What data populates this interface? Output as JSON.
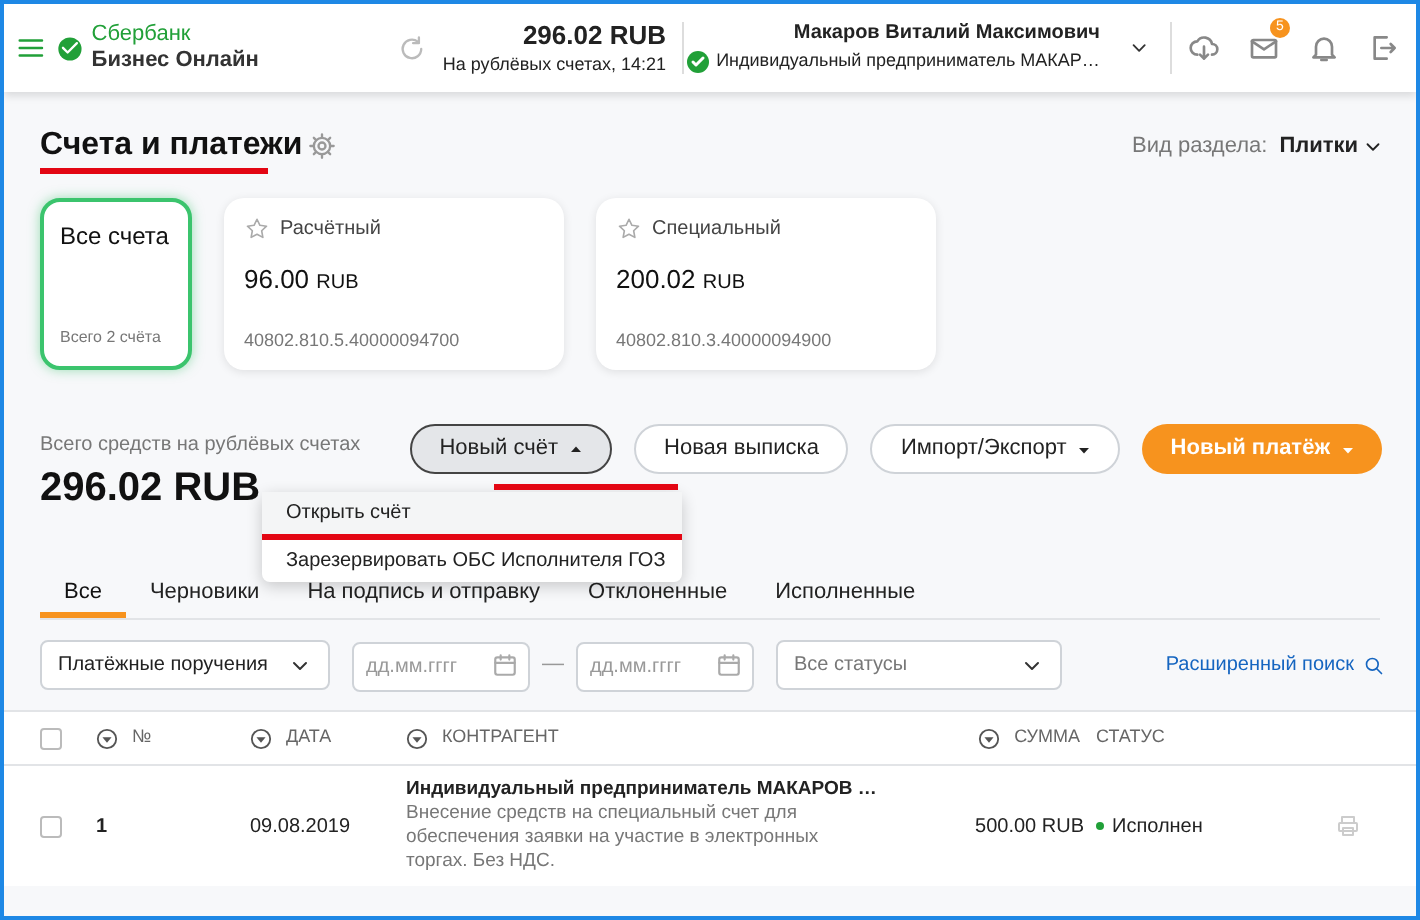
{
  "header": {
    "logo_line1": "Сбербанк",
    "logo_line2": "Бизнес Онлайн",
    "balance": "296.02 RUB",
    "balance_note": "На рублёвых счетах, 14:21",
    "user_name": "Макаров Виталий Максимович",
    "organization": "Индивидуальный предприниматель МАКАР…",
    "mail_badge": "5"
  },
  "page": {
    "title": "Счета и платежи",
    "view_label": "Вид раздела:",
    "view_value": "Плитки"
  },
  "account_cards": [
    {
      "kind": "all",
      "title": "Все счета",
      "note": "Всего 2 счёта",
      "selected": true
    },
    {
      "kind": "account",
      "title": "Расчётный",
      "amount": "96.00",
      "currency": "RUB",
      "number": "40802.810.5.40000094700",
      "selected": false
    },
    {
      "kind": "account",
      "title": "Специальный",
      "amount": "200.02",
      "currency": "RUB",
      "number": "40802.810.3.40000094900",
      "selected": false
    }
  ],
  "summary": {
    "label": "Всего средств на рублёвых счетах",
    "amount": "296.02 RUB"
  },
  "buttons": [
    {
      "kind": "dropdown",
      "label": "Новый счёт",
      "expanded": true
    },
    {
      "kind": "plain",
      "label": "Новая выписка"
    },
    {
      "kind": "dropdown",
      "label": "Импорт/Экспорт",
      "expanded": false
    },
    {
      "kind": "primary",
      "label": "Новый платёж",
      "expanded": false
    }
  ],
  "dropdown_menu": [
    "Открыть счёт",
    "Зарезервировать ОБС Исполнителя ГОЗ"
  ],
  "tabs": [
    {
      "label": "Все",
      "selected": true
    },
    {
      "label": "Черновики",
      "selected": false
    },
    {
      "label": "На подпись и отправку",
      "selected": false
    },
    {
      "label": "Отклоненные",
      "selected": false
    },
    {
      "label": "Исполненные",
      "selected": false
    }
  ],
  "filters": {
    "document_type": "Платёжные поручения",
    "date_from_placeholder": "дд.мм.гггг",
    "date_separator": "—",
    "date_to_placeholder": "дд.мм.гггг",
    "status": "Все статусы",
    "advanced_search": "Расширенный поиск"
  },
  "table": {
    "header_checked": false,
    "columns": [
      {
        "label": "№",
        "sortable": true
      },
      {
        "label": "ДАТА",
        "sortable": true
      },
      {
        "label": "КОНТРАГЕНТ",
        "sortable": true
      },
      {
        "label": "СУММА",
        "sortable": true
      },
      {
        "label": "СТАТУС",
        "sortable": false
      }
    ],
    "rows": [
      {
        "checked": false,
        "number": "1",
        "date": "09.08.2019",
        "counterparty": "Индивидуальный предприниматель МАКАРОВ …",
        "purpose": "Внесение средств на специальный счет для обеспечения заявки на участие в электронных торгах. Без НДС.",
        "amount": "500.00 RUB",
        "status": "Исполнен"
      }
    ]
  }
}
